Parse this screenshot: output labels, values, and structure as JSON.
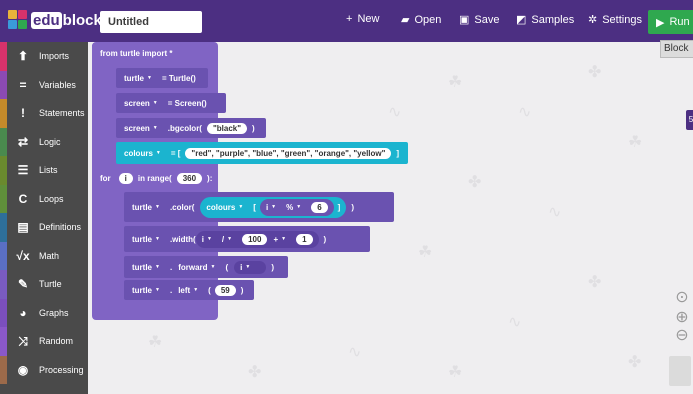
{
  "app": {
    "brand_left": "edu",
    "brand_right": "blocks",
    "project_title": "Untitled"
  },
  "header": {
    "new": "New",
    "open": "Open",
    "save": "Save",
    "samples": "Samples",
    "settings": "Settings",
    "run": "Run",
    "block_tab": "Block"
  },
  "sidebar": {
    "items": [
      {
        "label": "Imports",
        "icon": "upload-icon",
        "color": "#d8326b"
      },
      {
        "label": "Variables",
        "icon": "equals-icon",
        "color": "#8b4ab3"
      },
      {
        "label": "Statements",
        "icon": "exclamation-icon",
        "color": "#c48a2a"
      },
      {
        "label": "Logic",
        "icon": "arrows-icon",
        "color": "#4a8a4e"
      },
      {
        "label": "Lists",
        "icon": "list-icon",
        "color": "#6a8a2e"
      },
      {
        "label": "Loops",
        "icon": "loop-icon",
        "color": "#5f8f3a"
      },
      {
        "label": "Definitions",
        "icon": "definitions-icon",
        "color": "#2e6f9a"
      },
      {
        "label": "Math",
        "icon": "sqrt-icon",
        "color": "#5a6fc4"
      },
      {
        "label": "Turtle",
        "icon": "pencil-icon",
        "color": "#7a5bc0"
      },
      {
        "label": "Graphs",
        "icon": "pie-icon",
        "color": "#7b4fbd"
      },
      {
        "label": "Random",
        "icon": "shuffle-icon",
        "color": "#8a58c8"
      },
      {
        "label": "Processing",
        "icon": "palette-icon",
        "color": "#9c6a4a"
      }
    ]
  },
  "blocks": {
    "import": "from turtle import *",
    "turtle_var": "turtle",
    "turtle_ctor": "= Turtle()",
    "screen_var": "screen",
    "screen_ctor": "= Screen()",
    "bgcolor": ".bgcolor(",
    "bgcolor_val": "\"black\"",
    "close_paren": ")",
    "colours_var": "colours",
    "list_open": "= [",
    "list_vals": "\"red\", \"purple\", \"blue\", \"green\", \"orange\", \"yellow\"",
    "list_close": "]",
    "for_kw": "for",
    "for_var": "i",
    "in_range": "in range(",
    "range_val": "360",
    "for_close": "):",
    "color_call": ".color(",
    "index_open": "[",
    "index_close": "]",
    "mod_op": "%",
    "mod_val": "6",
    "width_call": ".width(",
    "div_op": "/",
    "div_val": "100",
    "plus_op": "+",
    "plus_val": "1",
    "dot": ".",
    "forward": "forward",
    "open_paren": "(",
    "left": "left",
    "left_val": "59"
  },
  "colors": {
    "topbar": "#4c2f82",
    "run": "#2fa84f",
    "sidebar": "#4a4a4a",
    "block_purple": "#8064c4",
    "block_cyan": "#1bb4cf"
  }
}
